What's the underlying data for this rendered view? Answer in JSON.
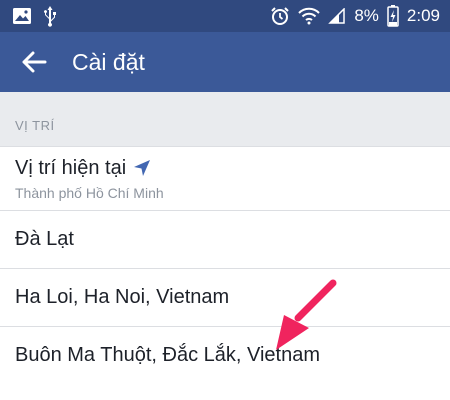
{
  "status_bar": {
    "left_icons": [
      "image-icon",
      "usb-icon"
    ],
    "right_icons": [
      "alarm-icon",
      "wifi-icon",
      "signal-icon",
      "battery-charging-icon"
    ],
    "battery": "8%",
    "time": "2:09"
  },
  "app_bar": {
    "back_icon": "back-arrow-icon",
    "title": "Cài đặt"
  },
  "section": {
    "header": "VỊ TRÍ"
  },
  "locations": [
    {
      "label": "Vị trí hiện tại",
      "sublabel": "Thành phố Hồ Chí Minh",
      "icon": "navigation-arrow-icon"
    },
    {
      "label": "Đà Lạt"
    },
    {
      "label": "Ha Loi, Ha Noi, Vietnam"
    },
    {
      "label": "Buôn Ma Thuột, Đắc Lắk, Vietnam"
    }
  ],
  "colors": {
    "status_bar": "#30497f",
    "app_bar": "#3b5998",
    "section_bg": "#e9ebee",
    "location_icon": "#4267b2",
    "annotation_arrow": "#f0245e"
  }
}
